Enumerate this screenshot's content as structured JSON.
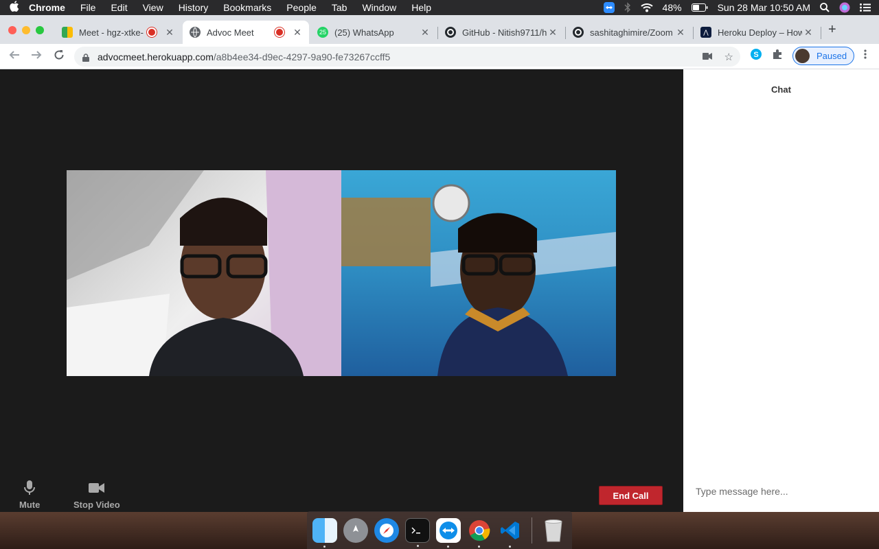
{
  "menubar": {
    "app": "Chrome",
    "items": [
      "File",
      "Edit",
      "View",
      "History",
      "Bookmarks",
      "People",
      "Tab",
      "Window",
      "Help"
    ],
    "battery": "48%",
    "datetime": "Sun 28 Mar  10:50 AM"
  },
  "tabs": [
    {
      "title": "Meet - hgz-xtke-",
      "recording": true
    },
    {
      "title": "Advoc Meet",
      "recording": true,
      "active": true
    },
    {
      "title": "(25) WhatsApp",
      "badge": "25"
    },
    {
      "title": "GitHub - Nitish9711/h"
    },
    {
      "title": "sashitaghimire/Zoom"
    },
    {
      "title": "Heroku Deploy – How"
    }
  ],
  "address": {
    "host": "advocmeet.herokuapp.com",
    "path": "/a8b4ee34-d9ec-4297-9a90-fe73267ccff5"
  },
  "profile": {
    "label": "Paused"
  },
  "meeting": {
    "mute_label": "Mute",
    "stop_video_label": "Stop Video",
    "end_call_label": "End Call"
  },
  "chat": {
    "title": "Chat",
    "placeholder": "Type message here..."
  },
  "dock": [
    "finder",
    "launchpad",
    "safari",
    "terminal",
    "teamviewer",
    "chrome",
    "vscode",
    "trash"
  ],
  "colors": {
    "stage_bg": "#1b1b1b",
    "end_call": "#c0262d",
    "chat_bg": "#ffffff"
  }
}
